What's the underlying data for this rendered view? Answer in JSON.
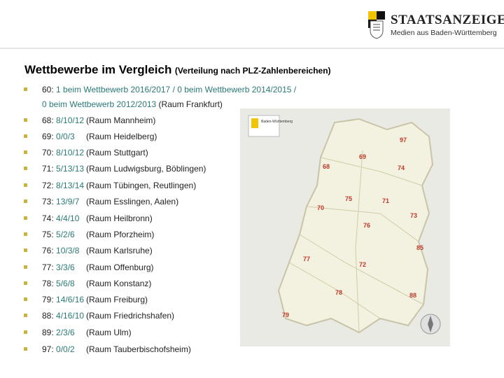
{
  "header": {
    "brand_title": "STAATSANZEIGER",
    "brand_subtitle": "Medien aus Baden-Württemberg"
  },
  "slide": {
    "title_main": "Wettbewerbe im Vergleich",
    "title_sub": "(Verteilung nach PLZ-Zahlenbereichen)"
  },
  "first_item": {
    "prefix": "60: ",
    "line1_values": "1 beim Wettbewerb 2016/2017 / 0 beim Wettbewerb 2014/2015 /",
    "line2_values": "0 beim Wettbewerb 2012/2013",
    "line2_place": " (Raum Frankfurt)"
  },
  "items": [
    {
      "code": "68: ",
      "values": "8/10/12",
      "place": "(Raum Mannheim)"
    },
    {
      "code": "69: ",
      "values": "0/0/3",
      "place": "(Raum Heidelberg)"
    },
    {
      "code": "70: ",
      "values": "8/10/12",
      "place": "(Raum Stuttgart)"
    },
    {
      "code": "71: ",
      "values": "5/13/13",
      "place": "(Raum Ludwigsburg, Böblingen)"
    },
    {
      "code": "72: ",
      "values": "8/13/14",
      "place": "(Raum Tübingen, Reutlingen)"
    },
    {
      "code": "73: ",
      "values": "13/9/7",
      "place": "(Raum Esslingen, Aalen)"
    },
    {
      "code": "74: ",
      "values": "4/4/10",
      "place": "(Raum Heilbronn)"
    },
    {
      "code": "75: ",
      "values": "5/2/6",
      "place": "(Raum Pforzheim)"
    },
    {
      "code": "76: ",
      "values": "10/3/8",
      "place": "(Raum Karlsruhe)"
    },
    {
      "code": "77: ",
      "values": "3/3/6",
      "place": "(Raum Offenburg)"
    },
    {
      "code": "78: ",
      "values": "5/6/8",
      "place": "(Raum Konstanz)"
    },
    {
      "code": "79: ",
      "values": "14/6/16",
      "place": "(Raum Freiburg)"
    },
    {
      "code": "88: ",
      "values": "4/16/10",
      "place": "(Raum Friedrichshafen)"
    },
    {
      "code": "89: ",
      "values": "2/3/6",
      "place": "(Raum Ulm)"
    },
    {
      "code": "97: ",
      "values": "0/0/2",
      "place": "(Raum Tauberbischofsheim)"
    }
  ],
  "map": {
    "legend_title": "Baden-Württemberg",
    "region_labels": [
      "97",
      "69",
      "68",
      "74",
      "75",
      "71",
      "70",
      "73",
      "76",
      "85",
      "77",
      "72",
      "78",
      "88",
      "79"
    ]
  },
  "colors": {
    "value_color": "#2a7a77",
    "bullet_color": "#c9b33b",
    "map_label_color": "#c0392b"
  }
}
